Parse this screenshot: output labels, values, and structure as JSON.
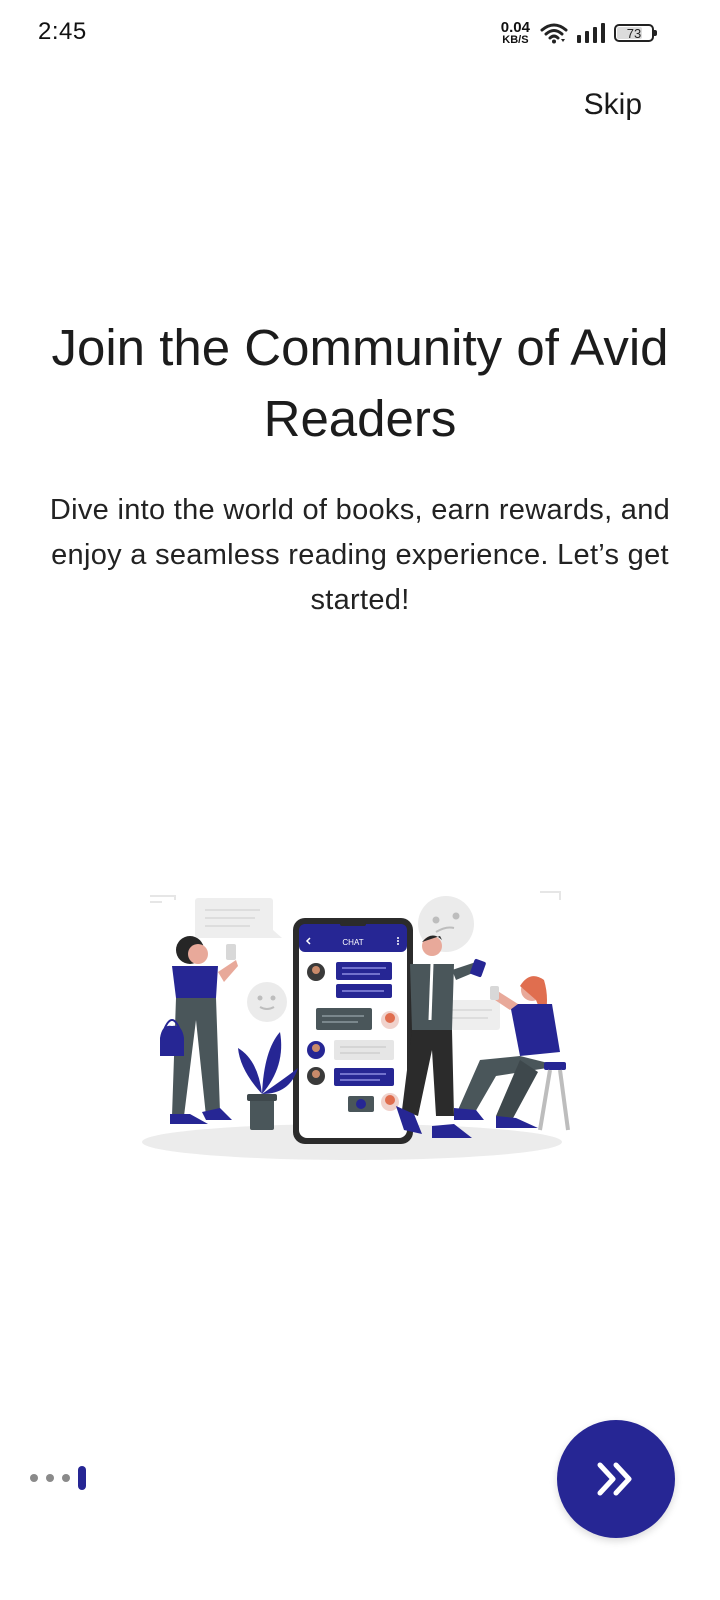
{
  "status_bar": {
    "time": "2:45",
    "net_speed_value": "0.04",
    "net_speed_unit": "KB/S",
    "battery_level": 73,
    "battery_label": "73"
  },
  "header": {
    "skip_label": "Skip"
  },
  "onboarding": {
    "title": "Join the Community of Avid Readers",
    "description": "Dive into the world of books, earn rewards, and enjoy a seamless reading experience. Let’s get started!",
    "illustration_chat_header": "CHAT"
  },
  "pager": {
    "total_pages": 4,
    "current_page": 4
  },
  "colors": {
    "accent": "#262694",
    "inactive_dot": "#8a8a8a",
    "text": "#1c1c1c"
  },
  "icons": {
    "next": "double-chevron-right-icon",
    "wifi": "wifi-icon",
    "signal": "signal-icon",
    "battery": "battery-icon"
  }
}
